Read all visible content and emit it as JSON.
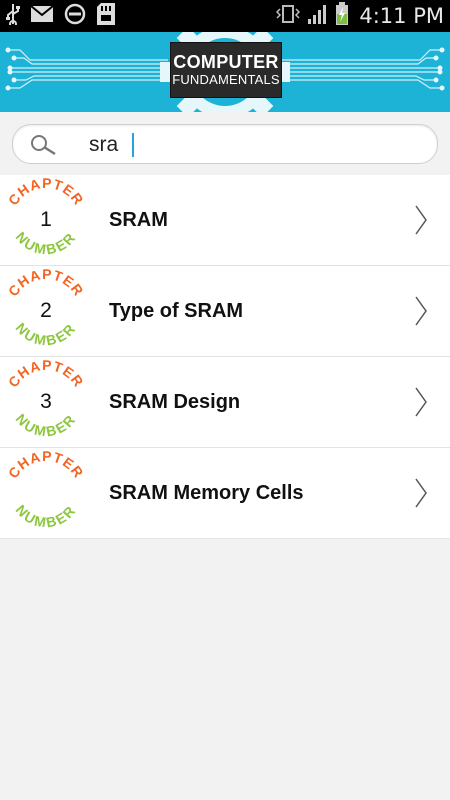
{
  "status_bar": {
    "time": "4:11 PM",
    "left_icons": [
      "usb-icon",
      "mail-icon",
      "do-not-disturb-icon",
      "sd-card-icon"
    ],
    "right_icons": [
      "vibrate-icon",
      "signal-icon",
      "battery-charging-icon"
    ]
  },
  "header": {
    "logo_line1": "COMPUTER",
    "logo_line2": "FUNDAMENTALS",
    "background_color": "#1cb3d6"
  },
  "search": {
    "value": "sra",
    "icon": "search-icon"
  },
  "results": [
    {
      "number": "1",
      "title": "SRAM"
    },
    {
      "number": "2",
      "title": "Type of SRAM"
    },
    {
      "number": "3",
      "title": "SRAM Design"
    },
    {
      "number": "",
      "title": "SRAM Memory Cells"
    }
  ],
  "badge": {
    "top_text": "CHAPTER",
    "bottom_text": "NUMBER",
    "top_color": "#f26522",
    "bottom_color": "#8dc63f"
  }
}
